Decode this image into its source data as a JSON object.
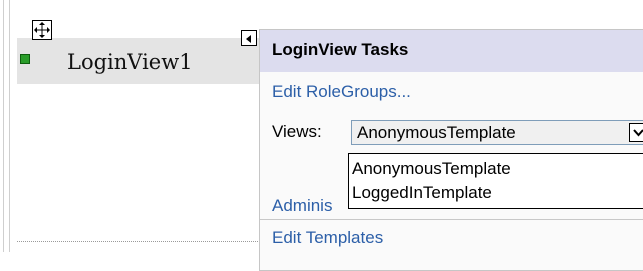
{
  "control": {
    "title": "LoginView1"
  },
  "tasks": {
    "title": "LoginView Tasks",
    "edit_rolegroups": "Edit RoleGroups...",
    "views_label": "Views:",
    "selected_view": "AnonymousTemplate",
    "administer_partial": "Adminis",
    "edit_templates": "Edit Templates"
  },
  "views_options": [
    "AnonymousTemplate",
    "LoggedInTemplate"
  ],
  "colors": {
    "header_bg": "#dcdcef",
    "link": "#2c5fa8",
    "control_header_bg": "#e4e4e4"
  },
  "icons": {
    "move": "move-icon",
    "smart_tag": "smart-tag-left-icon",
    "dropdown": "chevron-down-icon",
    "marker": "green-marker-icon"
  }
}
